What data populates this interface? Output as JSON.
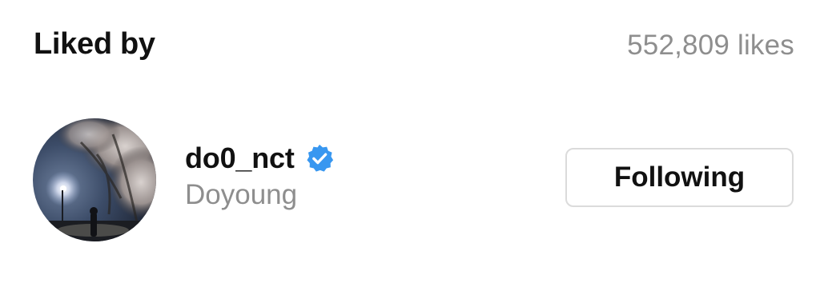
{
  "header": {
    "title": "Liked by",
    "likes_count": "552,809 likes"
  },
  "liker": {
    "username": "do0_nct",
    "full_name": "Doyoung",
    "verified": true,
    "verified_icon": "verified-badge-icon",
    "verified_color": "#3897f0",
    "follow_button_label": "Following"
  }
}
